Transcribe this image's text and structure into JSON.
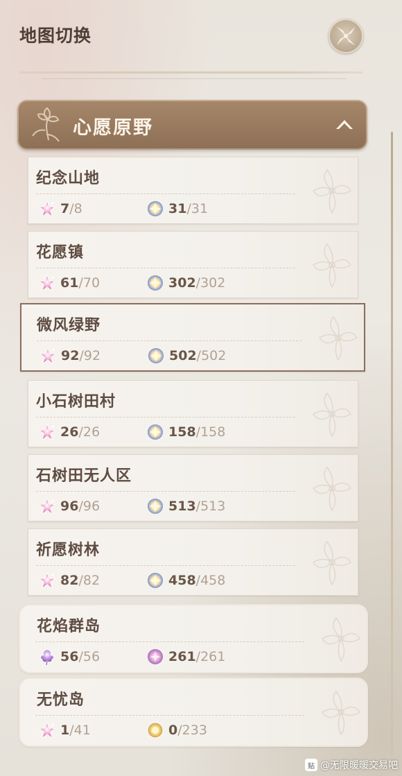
{
  "header": {
    "title": "地图切换",
    "close_icon": "close-x-icon"
  },
  "region": {
    "name": "心愿原野",
    "expanded": true,
    "flower_icon": "flower-emblem-icon",
    "chevron_icon": "chevron-up-icon"
  },
  "areas": [
    {
      "name": "纪念山地",
      "a_cur": "7",
      "a_tot": "8",
      "b_cur": "31",
      "b_tot": "31",
      "style": "normal",
      "a_icon": "pink-star-icon",
      "b_icon": "blue-sparkle-icon"
    },
    {
      "name": "花愿镇",
      "a_cur": "61",
      "a_tot": "70",
      "b_cur": "302",
      "b_tot": "302",
      "style": "normal",
      "a_icon": "pink-star-icon",
      "b_icon": "blue-sparkle-icon"
    },
    {
      "name": "微风绿野",
      "a_cur": "92",
      "a_tot": "92",
      "b_cur": "502",
      "b_tot": "502",
      "style": "selected",
      "a_icon": "pink-star-icon",
      "b_icon": "blue-sparkle-icon"
    },
    {
      "name": "小石树田村",
      "a_cur": "26",
      "a_tot": "26",
      "b_cur": "158",
      "b_tot": "158",
      "style": "normal",
      "a_icon": "pink-star-icon",
      "b_icon": "blue-sparkle-icon"
    },
    {
      "name": "石树田无人区",
      "a_cur": "96",
      "a_tot": "96",
      "b_cur": "513",
      "b_tot": "513",
      "style": "normal",
      "a_icon": "pink-star-icon",
      "b_icon": "blue-sparkle-icon"
    },
    {
      "name": "祈愿树林",
      "a_cur": "82",
      "a_tot": "82",
      "b_cur": "458",
      "b_tot": "458",
      "style": "normal",
      "a_icon": "pink-star-icon",
      "b_icon": "blue-sparkle-icon"
    },
    {
      "name": "花焰群岛",
      "a_cur": "56",
      "a_tot": "56",
      "b_cur": "261",
      "b_tot": "261",
      "style": "rounded",
      "a_icon": "purple-flower-icon",
      "b_icon": "pink-orb-icon"
    },
    {
      "name": "无忧岛",
      "a_cur": "1",
      "a_tot": "41",
      "b_cur": "0",
      "b_tot": "233",
      "style": "rounded",
      "a_icon": "pink-star-icon",
      "b_icon": "gold-orb-icon"
    }
  ],
  "watermark": {
    "logo": "贴",
    "text": "@无限暖暖交易吧"
  },
  "colors": {
    "region_bar": "#9a7b60",
    "selected_border": "#8b6d59",
    "text_primary": "#5e4c42",
    "text_muted": "#b0a194"
  }
}
